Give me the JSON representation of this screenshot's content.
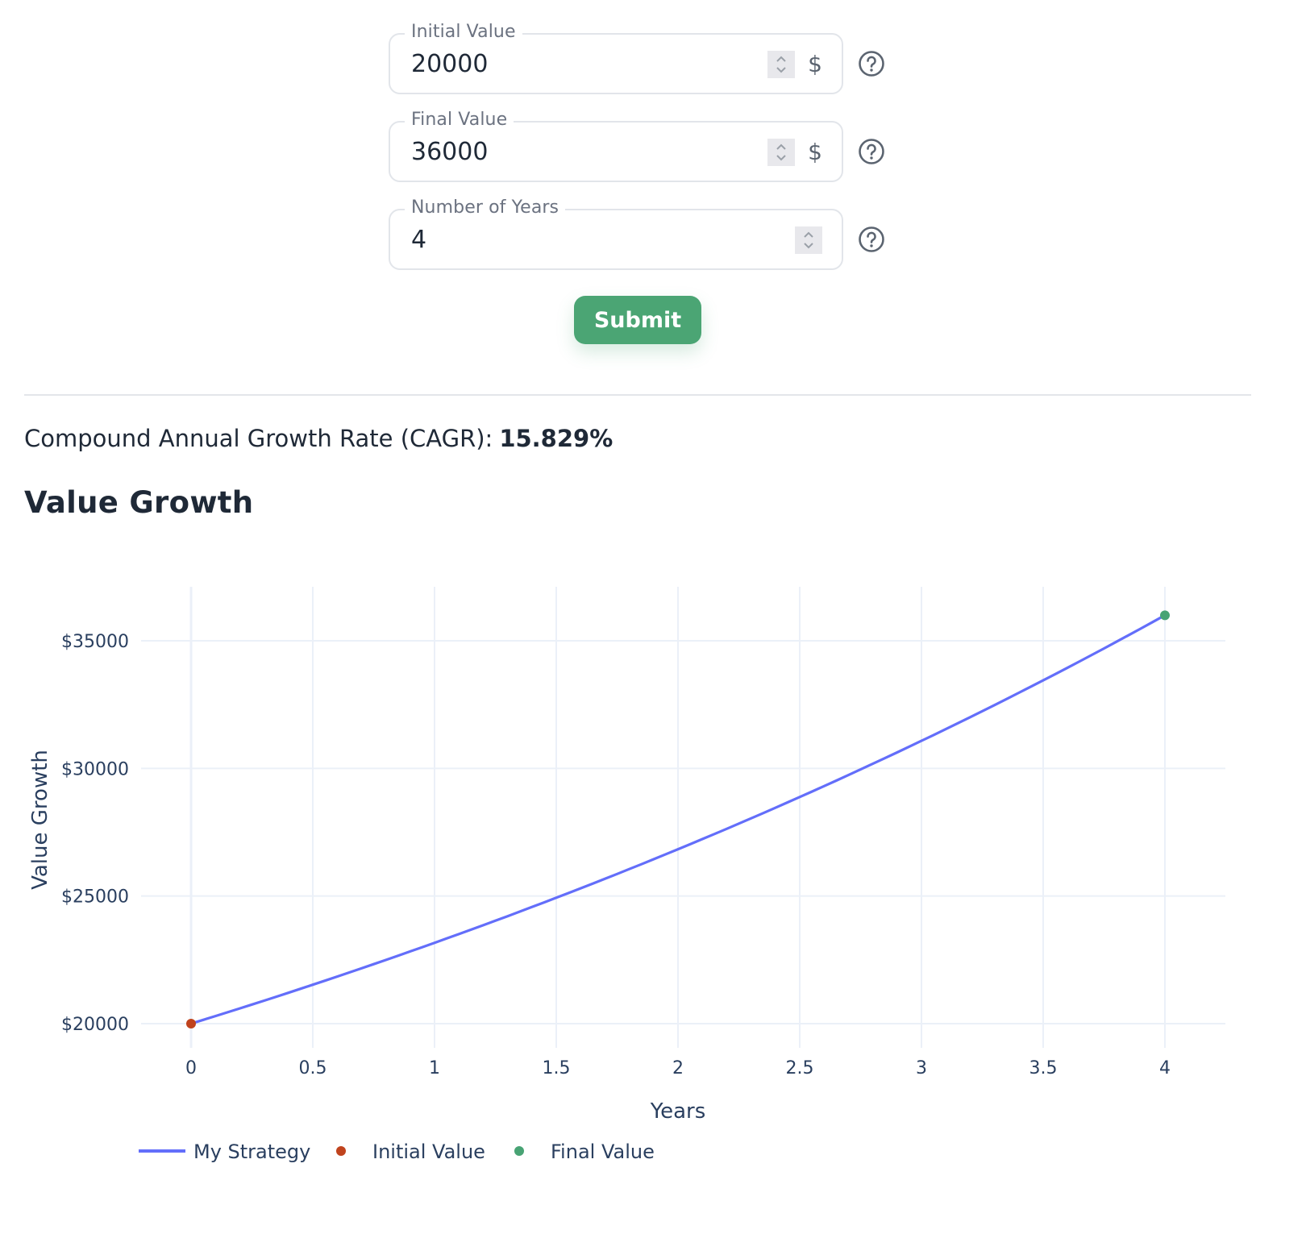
{
  "form": {
    "fields": [
      {
        "label": "Initial Value",
        "value": "20000",
        "suffix": "$",
        "help_icon": "question-circle-icon",
        "stepper_icon": "chevron-up-down-icon"
      },
      {
        "label": "Final Value",
        "value": "36000",
        "suffix": "$",
        "help_icon": "question-circle-icon",
        "stepper_icon": "chevron-up-down-icon"
      },
      {
        "label": "Number of Years",
        "value": "4",
        "suffix": "",
        "help_icon": "question-circle-icon",
        "stepper_icon": "chevron-up-down-icon"
      }
    ],
    "submit_label": "Submit"
  },
  "result": {
    "label": "Compound Annual Growth Rate (CAGR):",
    "value": "15.829%"
  },
  "section_title": "Value Growth",
  "colors": {
    "line": "#636efa",
    "initial_marker": "#c0431d",
    "final_marker": "#48a374",
    "accent_button": "#4ba574",
    "grid": "#ebf0f8",
    "axis_text": "#2a3f5f"
  },
  "chart_data": {
    "type": "line",
    "title": "",
    "xlabel": "Years",
    "ylabel": "Value Growth",
    "xlim": [
      -0.1,
      4.25
    ],
    "ylim": [
      19700,
      37150
    ],
    "x_ticks": [
      0,
      0.5,
      1,
      1.5,
      2,
      2.5,
      3,
      3.5,
      4
    ],
    "x_tick_labels": [
      "0",
      "0.5",
      "1",
      "1.5",
      "2",
      "2.5",
      "3",
      "3.5",
      "4"
    ],
    "y_ticks": [
      20000,
      25000,
      30000,
      35000
    ],
    "y_tick_labels": [
      "$20000",
      "$25000",
      "$30000",
      "$35000"
    ],
    "grid": true,
    "legend_position": "bottom-left",
    "series": [
      {
        "name": "My Strategy",
        "kind": "line",
        "x": [
          0,
          0.5,
          1,
          1.5,
          2,
          2.5,
          3,
          3.5,
          4
        ],
        "y": [
          20000,
          21525,
          23166,
          24932,
          26833,
          28879,
          31080,
          33450,
          36000
        ]
      },
      {
        "name": "Initial Value",
        "kind": "marker",
        "x": [
          0
        ],
        "y": [
          20000
        ]
      },
      {
        "name": "Final Value",
        "kind": "marker",
        "x": [
          4
        ],
        "y": [
          36000
        ]
      }
    ]
  }
}
